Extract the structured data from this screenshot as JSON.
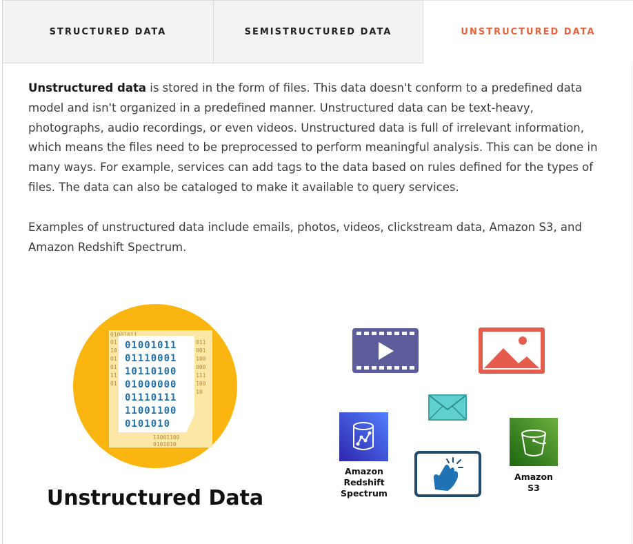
{
  "theme": {
    "accent": "#e8623a"
  },
  "tabs": [
    {
      "label": "STRUCTURED DATA",
      "active": false
    },
    {
      "label": "SEMISTRUCTURED DATA",
      "active": false
    },
    {
      "label": "UNSTRUCTURED DATA",
      "active": true
    }
  ],
  "content": {
    "lead_bold": "Unstructured data",
    "paragraph1_rest": " is stored in the form of files. This data doesn't conform to a predefined data model and isn't organized in a predefined manner. Unstructured data can be text-heavy, photographs, audio recordings, or even videos. Unstructured data is full of irrelevant information, which means the files need to be preprocessed to perform meaningful analysis. This can be done in many ways. For example, services can add tags to the data based on rules defined for the types of files. The data can also be cataloged to make it available to query services.",
    "paragraph2": "Examples of unstructured data include emails, photos, videos, clickstream data, Amazon S3, and Amazon Redshift Spectrum."
  },
  "figure": {
    "title": "Unstructured Data",
    "binary_lines": [
      "01001011",
      "01110001",
      "10110100",
      "01000000",
      "01110111",
      "11001100",
      "0101010"
    ],
    "back_lines_left": [
      "01",
      "10",
      "01",
      "01",
      "11",
      "01"
    ],
    "back_lines_right": [
      "011",
      "001",
      "100",
      "000",
      "111",
      "100",
      "10"
    ],
    "back_top": "01001011",
    "back_bottom": [
      "11001100",
      "0101010"
    ],
    "services": {
      "redshift": {
        "line1": "Amazon",
        "line2": "Redshift",
        "line3": "Spectrum"
      },
      "s3": {
        "line1": "Amazon",
        "line2": "S3"
      }
    },
    "icons": [
      "binary-document-icon",
      "video-icon",
      "image-icon",
      "email-icon",
      "redshift-icon",
      "clickstream-icon",
      "s3-bucket-icon"
    ]
  }
}
